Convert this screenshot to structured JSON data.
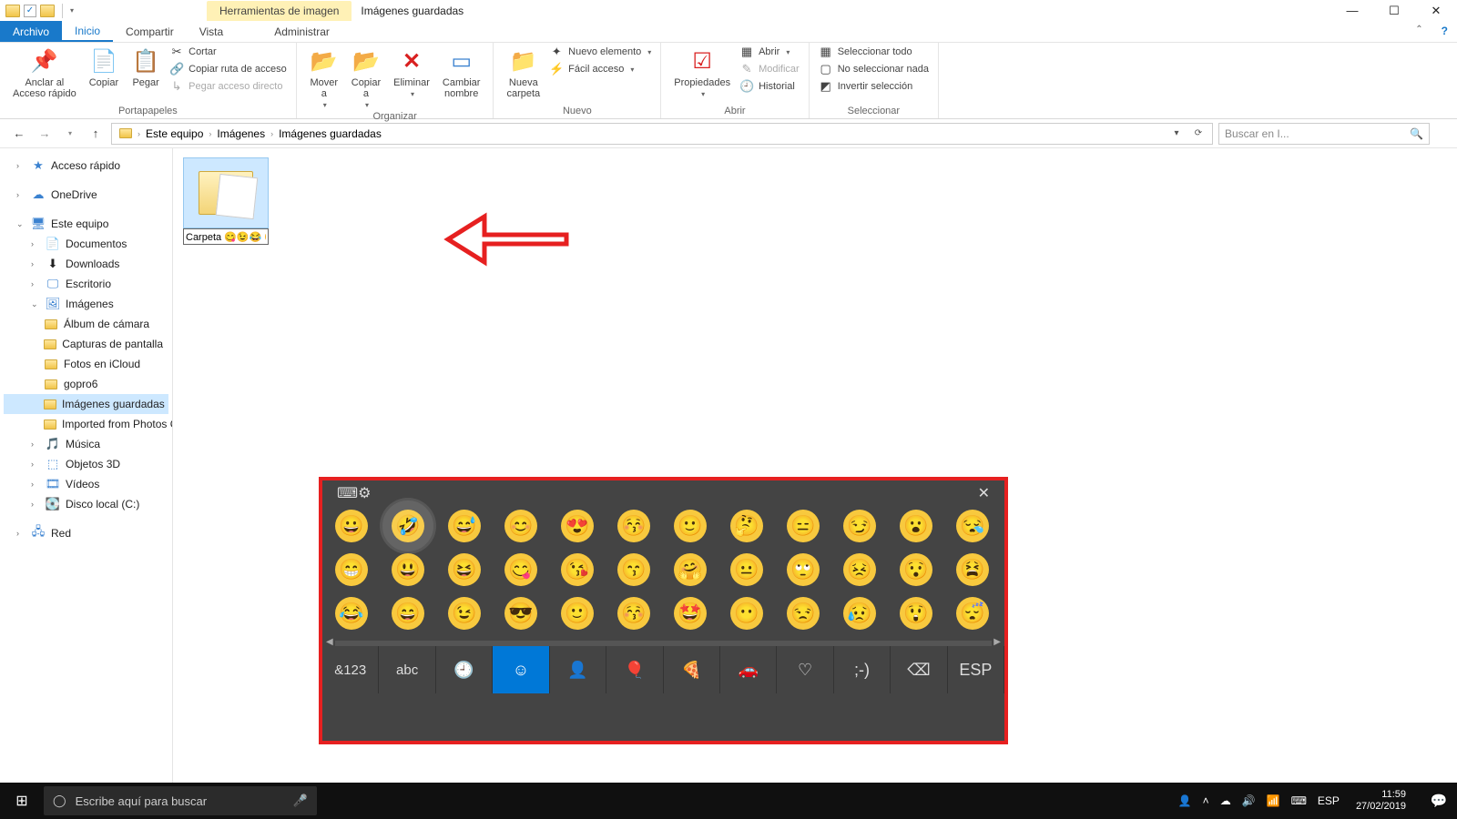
{
  "titlebar": {
    "context_tab": "Herramientas de imagen",
    "doc_title": "Imágenes guardadas"
  },
  "menu": {
    "file": "Archivo",
    "home": "Inicio",
    "share": "Compartir",
    "view": "Vista",
    "manage": "Administrar"
  },
  "ribbon": {
    "clipboard": {
      "pin": "Anclar al\nAcceso rápido",
      "copy": "Copiar",
      "paste": "Pegar",
      "cut": "Cortar",
      "copy_path": "Copiar ruta de acceso",
      "paste_shortcut": "Pegar acceso directo",
      "group": "Portapapeles"
    },
    "organize": {
      "move_to": "Mover\na",
      "copy_to": "Copiar\na",
      "delete": "Eliminar",
      "rename": "Cambiar\nnombre",
      "group": "Organizar"
    },
    "new": {
      "new_folder": "Nueva\ncarpeta",
      "new_item": "Nuevo elemento",
      "easy_access": "Fácil acceso",
      "group": "Nuevo"
    },
    "open": {
      "properties": "Propiedades",
      "open": "Abrir",
      "modify": "Modificar",
      "history": "Historial",
      "group": "Abrir"
    },
    "select": {
      "select_all": "Seleccionar todo",
      "select_none": "No seleccionar nada",
      "invert": "Invertir selección",
      "group": "Seleccionar"
    }
  },
  "address": {
    "crumbs": [
      "Este equipo",
      "Imágenes",
      "Imágenes guardadas"
    ],
    "search_placeholder": "Buscar en I..."
  },
  "sidebar": {
    "quick": "Acceso rápido",
    "onedrive": "OneDrive",
    "thispc": "Este equipo",
    "docs": "Documentos",
    "downloads": "Downloads",
    "desktop": "Escritorio",
    "pictures": "Imágenes",
    "pic_children": [
      "Álbum de cámara",
      "Capturas de pantalla",
      "Fotos en iCloud",
      "gopro6",
      "Imágenes guardadas",
      "Imported from Photos Com"
    ],
    "music": "Música",
    "objects3d": "Objetos 3D",
    "videos": "Vídeos",
    "disk": "Disco local (C:)",
    "network": "Red"
  },
  "file": {
    "rename_value": "Carpeta 😋😉😂 😊😄😆✍"
  },
  "emoji": {
    "rows": [
      [
        "😀",
        "🤣",
        "😅",
        "😊",
        "😍",
        "😚",
        "🙂",
        "🤔",
        "😑",
        "😏",
        "😮",
        "😪"
      ],
      [
        "😁",
        "😃",
        "😆",
        "😋",
        "😘",
        "😙",
        "🤗",
        "😐",
        "🙄",
        "😣",
        "😯",
        "😫"
      ],
      [
        "😂",
        "😄",
        "😉",
        "😎",
        "🙂",
        "😚",
        "🤩",
        "😶",
        "😒",
        "😥",
        "😲",
        "😴"
      ]
    ],
    "bottom": {
      "sym": "&123",
      "abc": "abc",
      "esp": "ESP"
    }
  },
  "taskbar": {
    "search": "Escribe aquí para buscar",
    "lang": "ESP",
    "time": "11:59",
    "date": "27/02/2019"
  }
}
